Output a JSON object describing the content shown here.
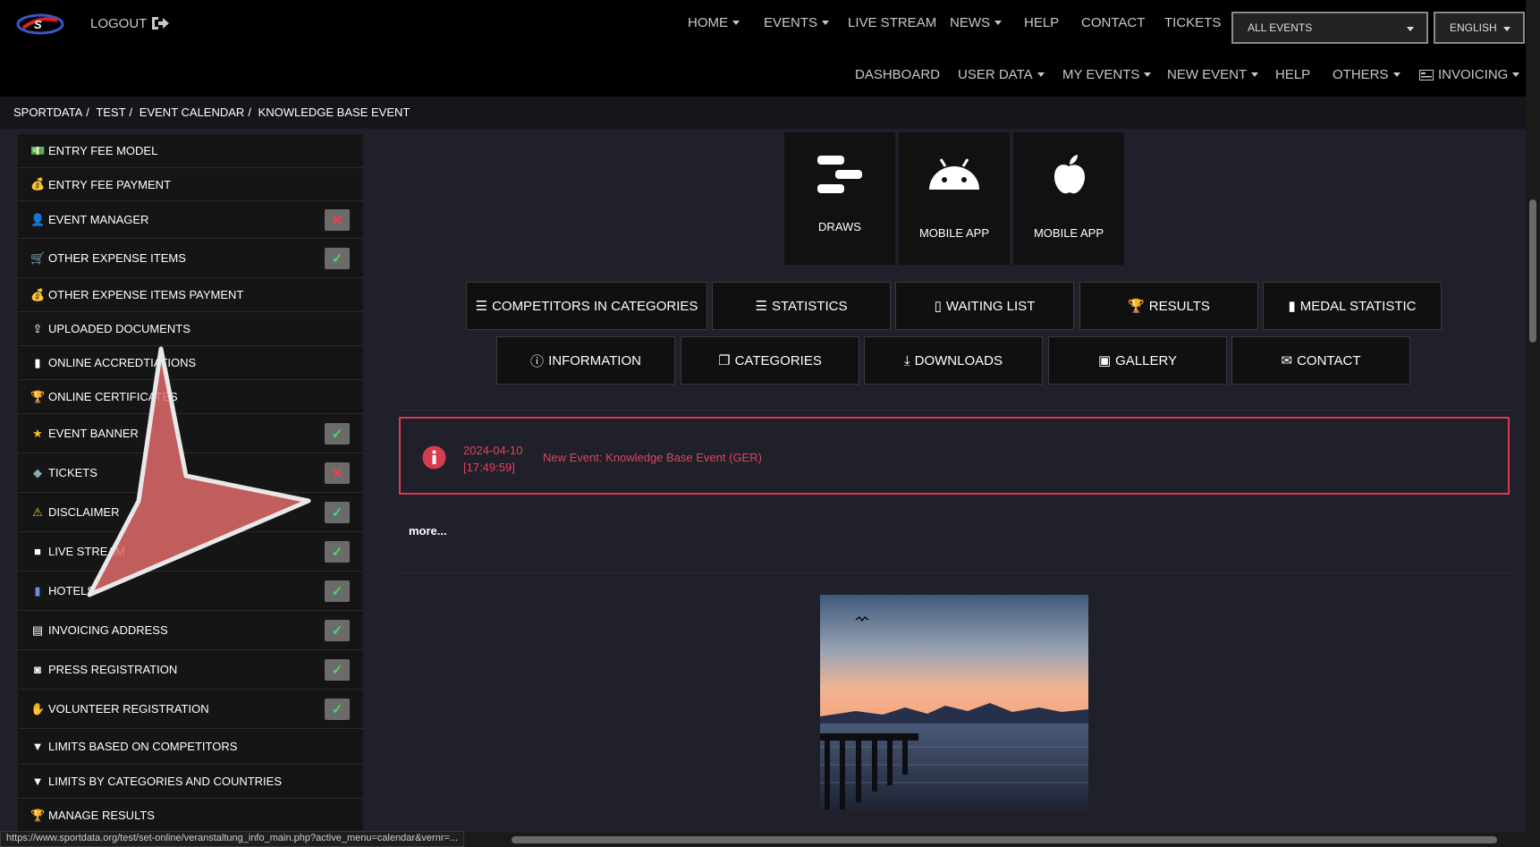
{
  "header": {
    "logout": "LOGOUT",
    "menu1": {
      "home": "HOME",
      "events": "EVENTS",
      "live_stream": "LIVE STREAM",
      "news": "NEWS",
      "help": "HELP",
      "contact": "CONTACT",
      "tickets": "TICKETS"
    },
    "event_select": "ALL EVENTS",
    "language_select": "ENGLISH",
    "menu2": {
      "dashboard": "DASHBOARD",
      "user_data": "USER DATA",
      "my_events": "MY EVENTS",
      "new_event": "NEW EVENT",
      "help": "HELP",
      "others": "OTHERS",
      "invoicing": "INVOICING"
    }
  },
  "breadcrumb": {
    "items": [
      "SPORTDATA",
      "TEST",
      "EVENT CALENDAR",
      "KNOWLEDGE BASE EVENT"
    ],
    "separator": "/"
  },
  "sidebar": {
    "items": [
      {
        "label": "ENTRY FEE MODEL",
        "status": null
      },
      {
        "label": "ENTRY FEE PAYMENT",
        "status": null
      },
      {
        "label": "EVENT MANAGER",
        "status": "no"
      },
      {
        "label": "OTHER EXPENSE ITEMS",
        "status": "ok"
      },
      {
        "label": "OTHER EXPENSE ITEMS PAYMENT",
        "status": null
      },
      {
        "label": "UPLOADED DOCUMENTS",
        "status": null
      },
      {
        "label": "ONLINE ACCREDTIATIONS",
        "status": null
      },
      {
        "label": "ONLINE CERTIFICATES",
        "status": null
      },
      {
        "label": "EVENT BANNER",
        "status": "ok"
      },
      {
        "label": "TICKETS",
        "status": "no"
      },
      {
        "label": "DISCLAIMER",
        "status": "ok"
      },
      {
        "label": "LIVE STREAM",
        "status": "ok"
      },
      {
        "label": "HOTELS",
        "status": "ok"
      },
      {
        "label": "INVOICING ADDRESS",
        "status": "ok"
      },
      {
        "label": "PRESS REGISTRATION",
        "status": "ok"
      },
      {
        "label": "VOLUNTEER REGISTRATION",
        "status": "ok"
      },
      {
        "label": "LIMITS BASED ON COMPETITORS",
        "status": null
      },
      {
        "label": "LIMITS BY CATEGORIES AND COUNTRIES",
        "status": null
      },
      {
        "label": "MANAGE RESULTS",
        "status": null
      }
    ]
  },
  "tiles": {
    "draws": "DRAWS",
    "mobile_android": "MOBILE APP",
    "mobile_ios": "MOBILE APP"
  },
  "buttons": {
    "competitors": "COMPETITORS IN CATEGORIES",
    "statistics": "STATISTICS",
    "waiting_list": "WAITING LIST",
    "results": "RESULTS",
    "medal_statistic": "MEDAL STATISTIC",
    "information": "INFORMATION",
    "categories": "CATEGORIES",
    "downloads": "DOWNLOADS",
    "gallery": "GALLERY",
    "contact": "CONTACT"
  },
  "news": {
    "date": "2024-04-10",
    "time": "[17:49:59]",
    "title": "New Event: Knowledge Base Event (GER)",
    "more": "more..."
  },
  "status_bar": "https://www.sportdata.org/test/set-online/veranstaltung_info_main.php?active_menu=calendar&vernr=...",
  "colors": {
    "alert": "#d63c4f",
    "check": "#4cd964",
    "cross": "#ff3b3b",
    "overlay_arrow": "#e06a6a"
  }
}
